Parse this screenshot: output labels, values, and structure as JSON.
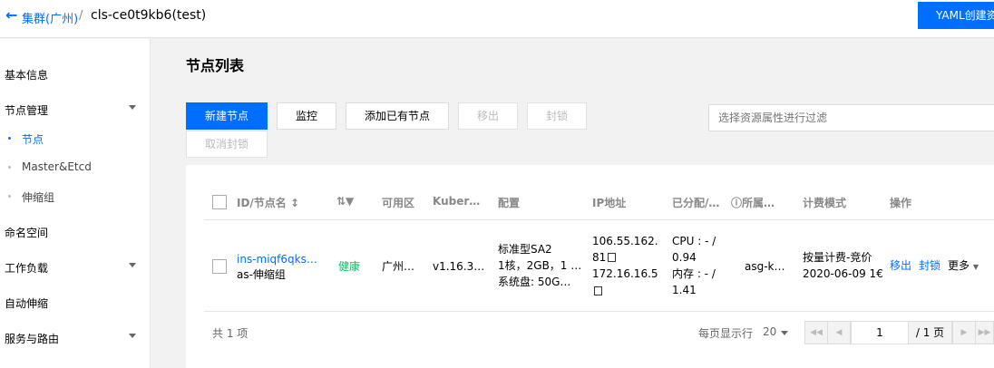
{
  "header": {
    "breadcrumb_parent": "集群(广州)",
    "breadcrumb_sep": "/",
    "breadcrumb_current": "cls-ce0t9kb6(test)",
    "yaml_button": "YAML创建资源"
  },
  "sidebar": {
    "items": [
      {
        "label": "基本信息"
      },
      {
        "label": "节点管理"
      },
      {
        "label": "节点"
      },
      {
        "label": "Master&Etcd"
      },
      {
        "label": "伸缩组"
      },
      {
        "label": "命名空间"
      },
      {
        "label": "工作负载"
      },
      {
        "label": "自动伸缩"
      },
      {
        "label": "服务与路由"
      }
    ]
  },
  "main": {
    "title": "节点列表",
    "buttons": {
      "new_node": "新建节点",
      "monitor": "监控",
      "add_existing": "添加已有节点",
      "remove": "移出",
      "cordon": "封锁",
      "uncordon": "取消封锁"
    },
    "filter_placeholder": "选择资源属性进行过滤",
    "columns": [
      "ID/节点名",
      "可用区",
      "Kuber…",
      "配置",
      "IP地址",
      "已分配/…",
      "所属…",
      "计费模式",
      "操作"
    ],
    "row": {
      "id": "ins-miqf6qks…",
      "name": "as-伸缩组",
      "status": "健康",
      "zone": "广州…",
      "version": "v1.16.3…",
      "config_line1": "标准型SA2",
      "config_line2": "1核，2GB，1 …",
      "config_line3": "系统盘: 50G…",
      "ip_line1": "106.55.162.",
      "ip_line2": "81",
      "ip_line3": "172.16.16.5",
      "alloc_line1": "CPU : - /",
      "alloc_line2": "0.94",
      "alloc_line3": "内存 : - /",
      "alloc_line4": "1.41",
      "group": "asg-k…",
      "billing_line1": "按量计费-竞价",
      "billing_line2": "2020-06-09 1€",
      "action_remove": "移出",
      "action_cordon": "封锁",
      "action_more": "更多"
    },
    "pager": {
      "total": "共 1 项",
      "per_page_label": "每页显示行",
      "per_page": "20",
      "current_page": "1",
      "total_pages": "/ 1 页"
    }
  }
}
